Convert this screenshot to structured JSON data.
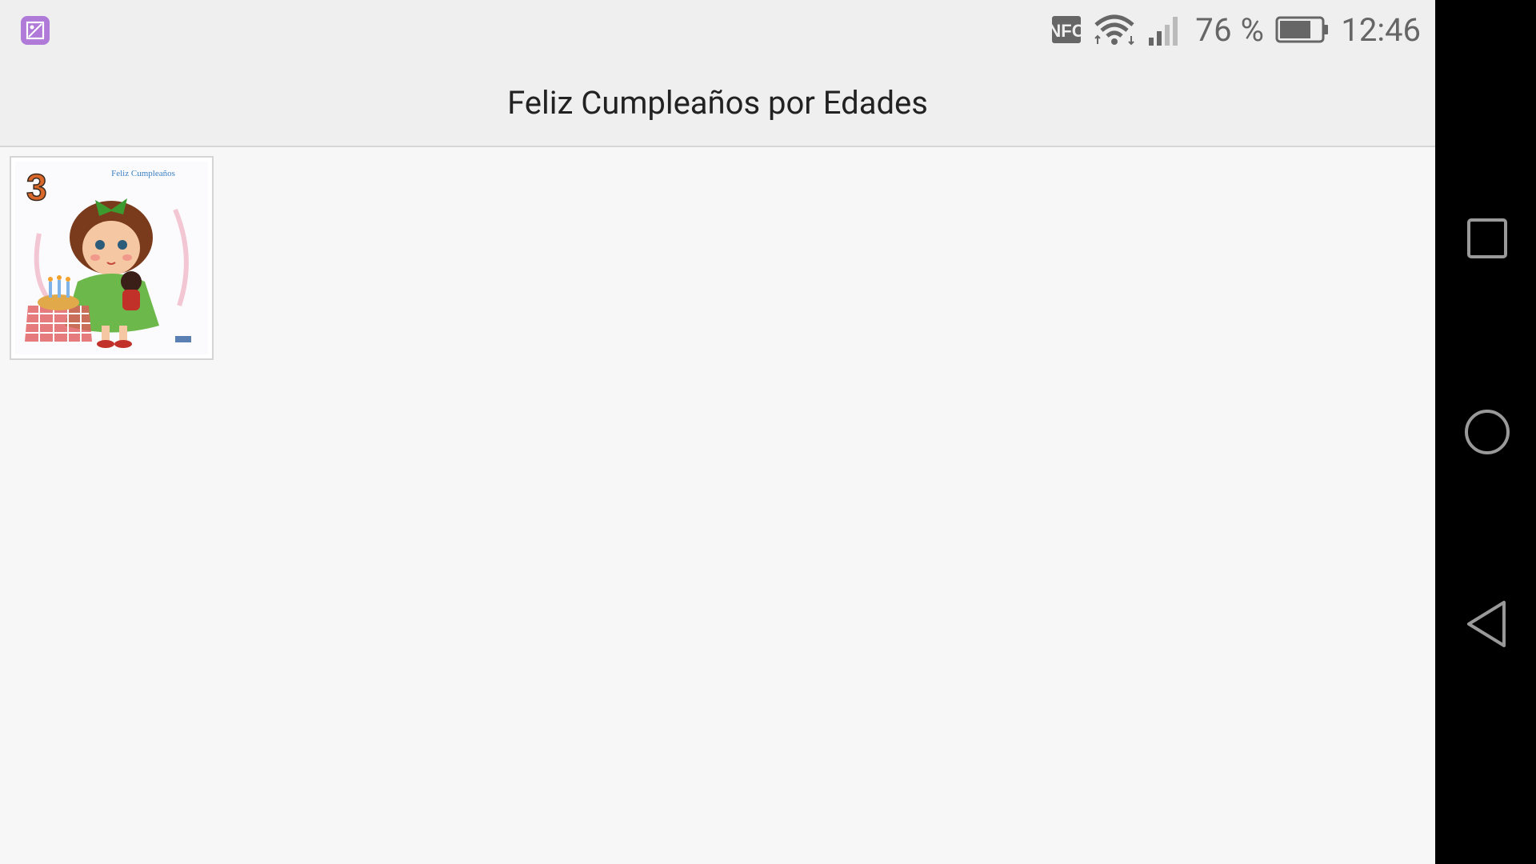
{
  "status_bar": {
    "notification_icon": "gallery-image-icon",
    "nfc_icon": "nfc-icon",
    "wifi_icon": "wifi-icon",
    "signal_icon": "cell-signal-icon",
    "battery_percent": "76 %",
    "battery_icon": "battery-icon",
    "battery_level": 0.76,
    "time": "12:46"
  },
  "action_bar": {
    "title": "Feliz Cumpleaños por Edades"
  },
  "gallery": {
    "items": [
      {
        "image": "birthday-card-age-3",
        "card_text": "Feliz Cumpleaños",
        "age": "3"
      }
    ]
  },
  "navigation_bar": {
    "recents_icon": "square-recents-icon",
    "home_icon": "circle-home-icon",
    "back_icon": "triangle-back-icon"
  },
  "colors": {
    "status_bar_bg": "#efefef",
    "content_bg": "#f7f7f7",
    "app_icon": "#b07ad8",
    "nav_bg": "#000000"
  }
}
